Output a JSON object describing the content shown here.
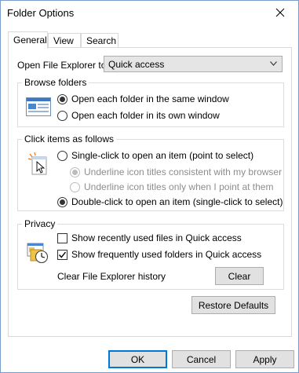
{
  "window": {
    "title": "Folder Options",
    "close_label": "close"
  },
  "tabs": [
    {
      "label": "General",
      "active": true
    },
    {
      "label": "View",
      "active": false
    },
    {
      "label": "Search",
      "active": false
    }
  ],
  "open_explorer": {
    "label": "Open File Explorer to:",
    "value": "Quick access"
  },
  "browse_folders": {
    "title": "Browse folders",
    "options": [
      {
        "label": "Open each folder in the same window",
        "checked": true
      },
      {
        "label": "Open each folder in its own window",
        "checked": false
      }
    ]
  },
  "click_items": {
    "title": "Click items as follows",
    "single_click": {
      "label": "Single-click to open an item (point to select)",
      "checked": false
    },
    "underline_consistent": {
      "label": "Underline icon titles consistent with my browser",
      "checked": true,
      "disabled": true
    },
    "underline_point": {
      "label": "Underline icon titles only when I point at them",
      "checked": false,
      "disabled": true
    },
    "double_click": {
      "label": "Double-click to open an item (single-click to select)",
      "checked": true
    }
  },
  "privacy": {
    "title": "Privacy",
    "recent_files": {
      "label": "Show recently used files in Quick access",
      "checked": false
    },
    "frequent_folders": {
      "label": "Show frequently used folders in Quick access",
      "checked": true
    },
    "clear_history_label": "Clear File Explorer history",
    "clear_button": "Clear"
  },
  "restore_defaults": "Restore Defaults",
  "footer": {
    "ok": "OK",
    "cancel": "Cancel",
    "apply": "Apply"
  },
  "colors": {
    "accent": "#0078d7",
    "button_bg": "#e1e1e1",
    "border": "#adadad",
    "window_border": "#7a9cc8"
  }
}
